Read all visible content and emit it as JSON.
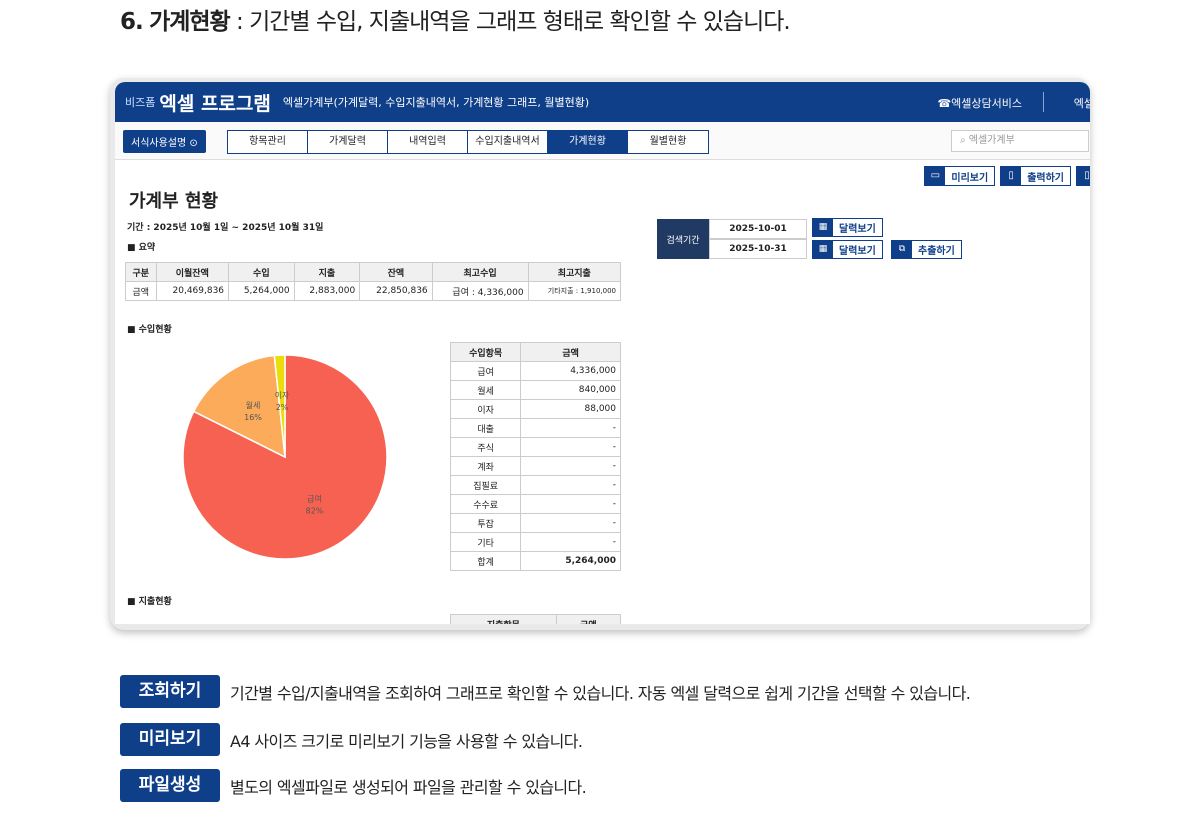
{
  "heading": {
    "number": "6.",
    "title": "가계현황",
    "desc": " : 기간별 수입, 지출내역을 그래프 형태로 확인할 수 있습니다."
  },
  "app": {
    "brand_small": "비즈폼",
    "brand": "엑셀 프로그램",
    "subtitle": "엑셀가계부(가계달력, 수입지출내역서, 가계현황 그래프, 월별현황)",
    "consult": "☎엑셀상담서비스",
    "more": "엑셀"
  },
  "nav": {
    "guide": "서식사용설명 ⊙",
    "tabs": [
      "항목관리",
      "가계달력",
      "내역입력",
      "수입지출내역서",
      "가계현황",
      "월별현황"
    ],
    "active": 4,
    "search_placeholder": "엑셀가계부"
  },
  "toolbar": {
    "preview": "미리보기",
    "print": "출력하기"
  },
  "page": {
    "title": "가계부 현황",
    "period": "기간 : 2025년 10월 1일 ~ 2025년 10월 31일",
    "summary_label": "■ 요약",
    "income_label": "■ 수입현황",
    "expense_label": "■ 지출현황"
  },
  "summary": {
    "headers": [
      "구분",
      "이월잔액",
      "수입",
      "지출",
      "잔액",
      "최고수입",
      "최고지출"
    ],
    "row": [
      "금액",
      "20,469,836",
      "5,264,000",
      "2,883,000",
      "22,850,836",
      "급여 : 4,336,000",
      "기타지출 : 1,910,000"
    ]
  },
  "search": {
    "label": "검색기간",
    "start": "2025-10-01",
    "end": "2025-10-31",
    "calendar": "달력보기",
    "extract": "추출하기"
  },
  "income_table": {
    "headers": [
      "수입항목",
      "금액"
    ],
    "rows": [
      [
        "급여",
        "4,336,000"
      ],
      [
        "월세",
        "840,000"
      ],
      [
        "이자",
        "88,000"
      ],
      [
        "대출",
        "-"
      ],
      [
        "주식",
        "-"
      ],
      [
        "계좌",
        "-"
      ],
      [
        "집필료",
        "-"
      ],
      [
        "수수료",
        "-"
      ],
      [
        "투잡",
        "-"
      ],
      [
        "기타",
        "-"
      ]
    ],
    "total": [
      "합계",
      "5,264,000"
    ]
  },
  "expense_table": {
    "headers": [
      "지출항목",
      "금액"
    ]
  },
  "chart_data": {
    "type": "pie",
    "title": "수입현황",
    "labels": [
      "급여",
      "월세",
      "이자"
    ],
    "values": [
      4336000,
      840000,
      88000
    ],
    "percent_labels": [
      "82%",
      "16%",
      "2%"
    ],
    "colors": [
      "#f76152",
      "#fbab5a",
      "#ecdc0c"
    ]
  },
  "features": [
    {
      "badge": "조회하기",
      "text": "기간별 수입/지출내역을 조회하여 그래프로 확인할 수 있습니다. 자동 엑셀 달력으로 쉽게 기간을 선택할 수 있습니다."
    },
    {
      "badge": "미리보기",
      "text": "A4 사이즈 크기로 미리보기 기능을 사용할 수 있습니다."
    },
    {
      "badge": "파일생성",
      "text": "별도의 엑셀파일로 생성되어 파일을 관리할 수 있습니다."
    }
  ]
}
